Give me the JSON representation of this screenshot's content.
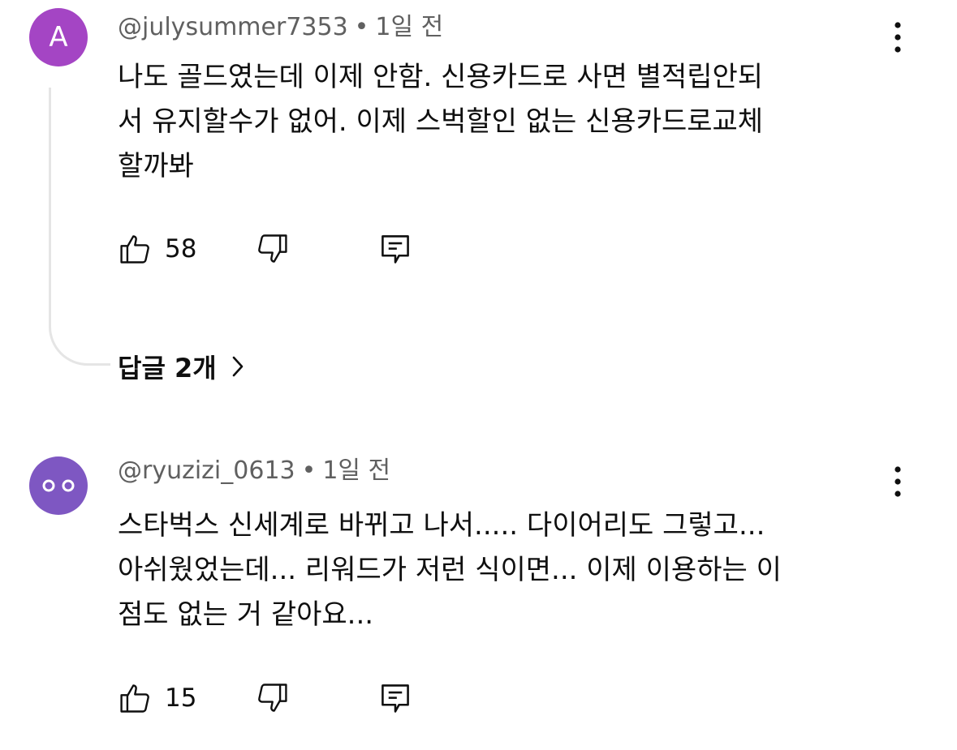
{
  "comments": [
    {
      "avatar_letter": "A",
      "avatar_color": "#a445c4",
      "author": "@julysummer7353",
      "separator": "•",
      "time": "1일 전",
      "text_lines": [
        "나도 골드였는데 이제 안함. 신용카드로 사면 별적립안되",
        "서 유지할수가 없어. 이제 스벅할인 없는 신용카드로교체",
        "할까봐"
      ],
      "likes": "58",
      "replies_label": "답글 2개"
    },
    {
      "avatar_color": "#7e57c2",
      "author": "@ryuzizi_0613",
      "separator": "•",
      "time": "1일 전",
      "text_lines": [
        "스타벅스 신세계로 바뀌고 나서..... 다이어리도 그렇고...",
        "아쉬웠었는데... 리워드가 저런 식이면... 이제 이용하는 이",
        "점도 없는 거 같아요..."
      ],
      "likes": "15"
    }
  ],
  "icons": {
    "like": "thumbs-up-icon",
    "dislike": "thumbs-down-icon",
    "reply": "comment-icon",
    "menu": "more-vertical-icon",
    "chevron": "chevron-right-icon"
  }
}
